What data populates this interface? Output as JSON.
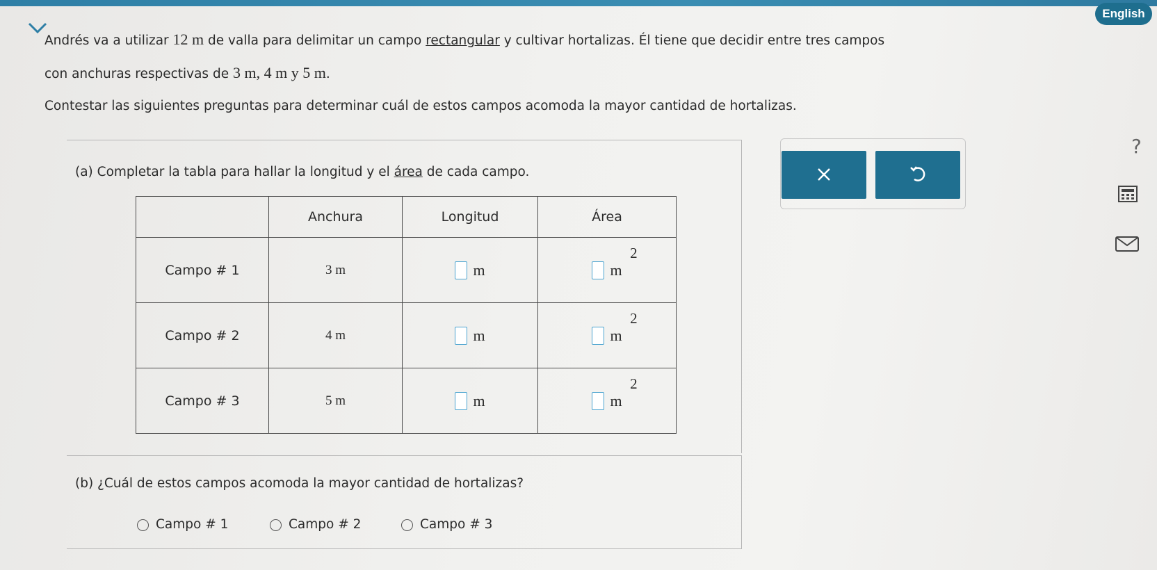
{
  "header": {
    "language_button": "English"
  },
  "problem": {
    "line1_a": "Andrés va a utilizar ",
    "line1_math": "12 m",
    "line1_b": " de valla para delimitar un campo ",
    "line1_link": "rectangular",
    "line1_c": " y cultivar hortalizas. Él tiene que decidir entre tres campos",
    "line2_a": "con anchuras respectivas de ",
    "line2_math": "3 m, 4 m y 5 m",
    "line2_b": ".",
    "instruction": "Contestar las siguientes preguntas para determinar cuál de estos campos acomoda la mayor cantidad de hortalizas."
  },
  "part_a": {
    "prompt_a": "(a) Completar la tabla para hallar la longitud y el ",
    "prompt_link": "área",
    "prompt_b": " de cada campo.",
    "table": {
      "headers": [
        "",
        "Anchura",
        "Longitud",
        "Área"
      ],
      "rows": [
        {
          "label": "Campo # 1",
          "anchura": "3 m",
          "longitud": "",
          "area": ""
        },
        {
          "label": "Campo # 2",
          "anchura": "4 m",
          "longitud": "",
          "area": ""
        },
        {
          "label": "Campo # 3",
          "anchura": "5 m",
          "longitud": "",
          "area": ""
        }
      ],
      "unit_length": "m",
      "unit_area": "m",
      "area_exponent": "2"
    }
  },
  "part_b": {
    "prompt": "(b) ¿Cuál de estos campos acomoda la mayor cantidad de hortalizas?",
    "options": [
      "Campo # 1",
      "Campo # 2",
      "Campo # 3"
    ]
  },
  "tools": {
    "clear_icon": "x-icon",
    "undo_icon": "undo-icon",
    "help_text": "?"
  },
  "colors": {
    "accent": "#1f6f90",
    "input_border": "#4aa3cf",
    "top_bar": "#2f7fa6"
  }
}
